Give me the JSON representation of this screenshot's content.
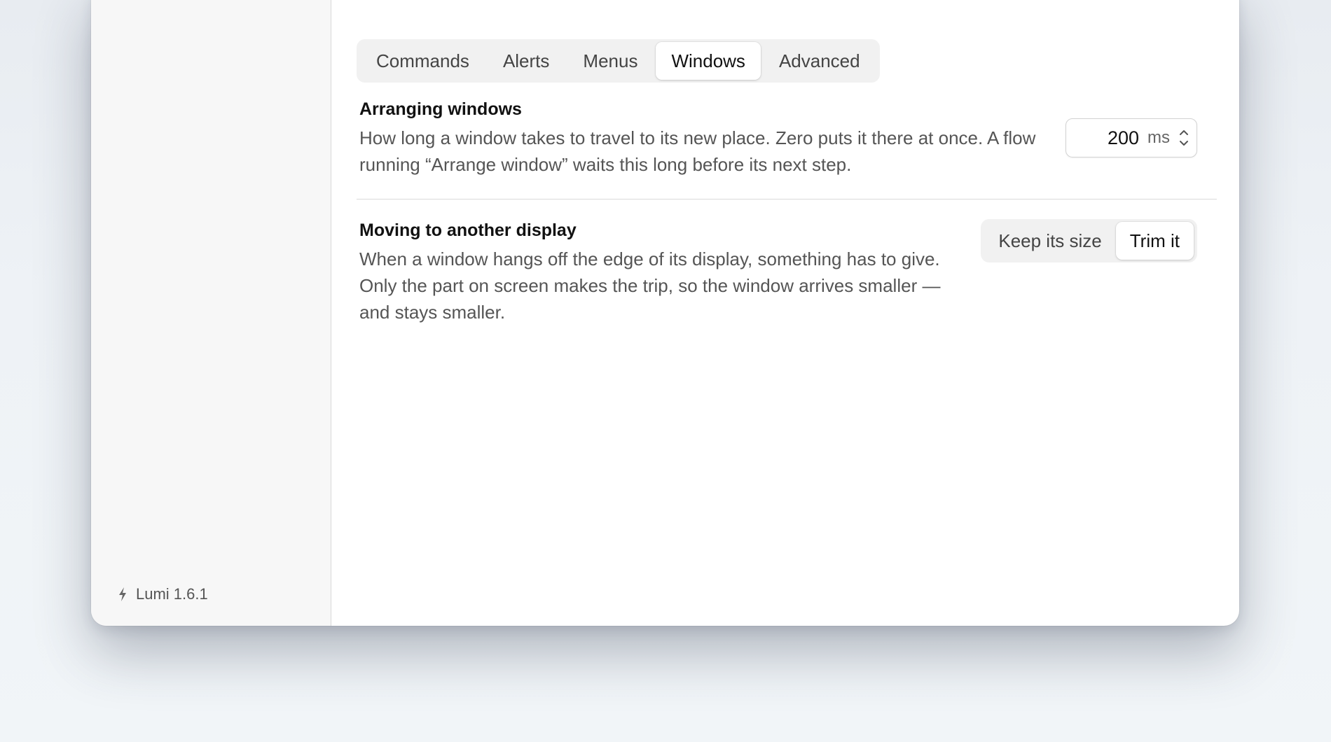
{
  "app": {
    "version_label": "Lumi 1.6.1"
  },
  "tabs": [
    {
      "label": "Commands",
      "active": false
    },
    {
      "label": "Alerts",
      "active": false
    },
    {
      "label": "Menus",
      "active": false
    },
    {
      "label": "Windows",
      "active": true
    },
    {
      "label": "Advanced",
      "active": false
    }
  ],
  "arranging": {
    "title": "Arranging windows",
    "description": "How long a window takes to travel to its new place. Zero puts it there at once. A flow running “Arrange window” waits this long before its next step.",
    "value": "200",
    "unit": "ms"
  },
  "moving": {
    "title": "Moving to another display",
    "description": "When a window hangs off the edge of its display, something has to give. Only the part on screen makes the trip, so the window arrives smaller — and stays smaller.",
    "options": [
      {
        "label": "Keep its size",
        "selected": false
      },
      {
        "label": "Trim it",
        "selected": true
      }
    ]
  },
  "icons": {
    "footer_icon": "bolt-icon",
    "stepper_up": "chevron-up-icon",
    "stepper_down": "chevron-down-icon"
  }
}
